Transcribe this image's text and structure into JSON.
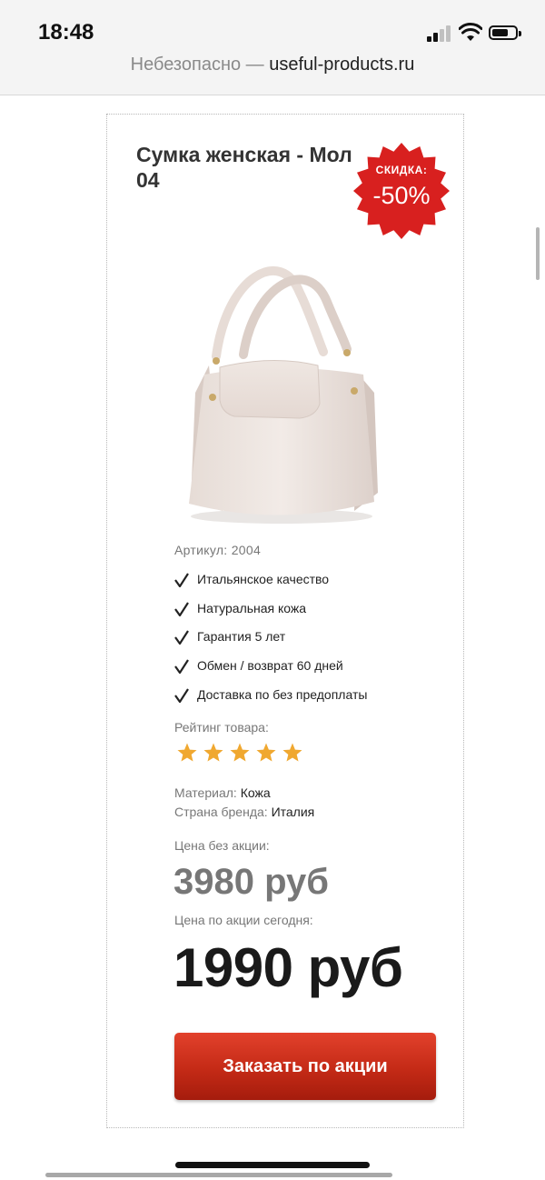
{
  "status_bar": {
    "time": "18:48"
  },
  "browser": {
    "security_label": "Небезопасно",
    "separator": " — ",
    "host": "useful-products.ru"
  },
  "product": {
    "title_line1": "Сумка женская - Мол",
    "title_line2": "04",
    "badge": {
      "label": "СКИДКА:",
      "value": "-50%",
      "color": "#d8201f"
    },
    "sku_label": "Артикул:",
    "sku_value": "2004",
    "features": [
      "Итальянское качество",
      "Натуральная кожа",
      "Гарантия 5 лет",
      "Обмен / возврат 60 дней",
      "Доставка по без предоплаты"
    ],
    "rating_label": "Рейтинг товара:",
    "rating_value": 5,
    "rating_max": 5,
    "star_color": "#f0a830",
    "material_label": "Материал:",
    "material_value": "Кожа",
    "country_label": "Страна бренда:",
    "country_value": "Италия",
    "old_price_label": "Цена без акции:",
    "old_price": "3980 руб",
    "new_price_label": "Цена по акции сегодня:",
    "new_price": "1990 руб",
    "order_button": "Заказать по акции",
    "button_color": "#c42a16"
  }
}
